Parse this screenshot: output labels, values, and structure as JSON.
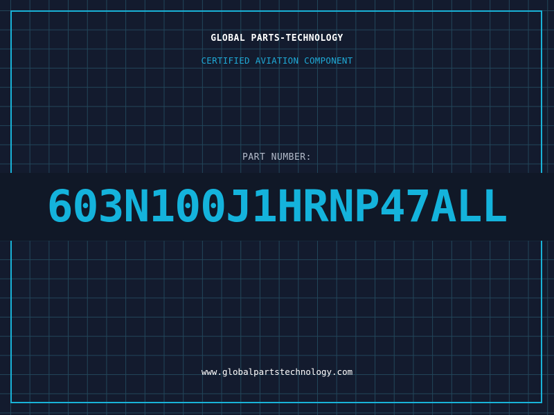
{
  "header": {
    "company": "GLOBAL PARTS-TECHNOLOGY",
    "subtitle": "CERTIFIED AVIATION COMPONENT"
  },
  "part": {
    "label": "PART NUMBER:",
    "number": "603N100J1HRNP47ALL"
  },
  "footer": {
    "website": "www.globalpartstechnology.com"
  },
  "colors": {
    "background": "#131b2e",
    "grid": "#22465a",
    "accent": "#19b3d8",
    "text": "#ffffff"
  }
}
